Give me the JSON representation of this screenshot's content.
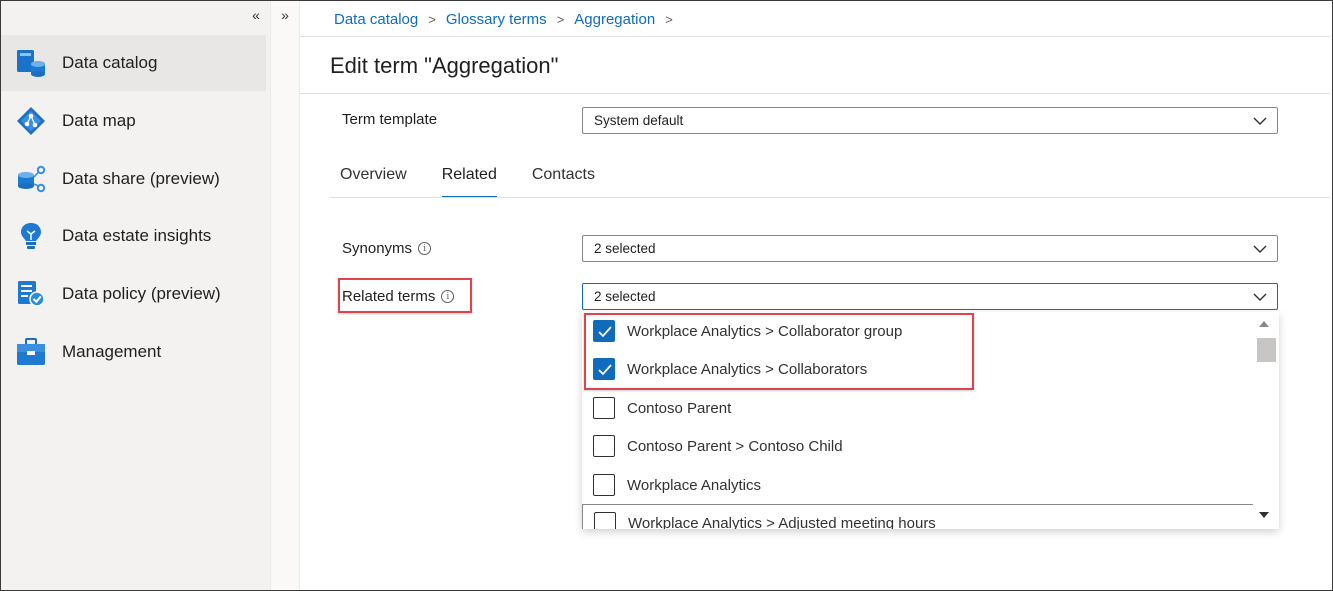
{
  "nav": {
    "collapse_label": "«",
    "expand_label": "»",
    "items": [
      {
        "label": "Data catalog",
        "icon": "data-catalog-icon",
        "active": true
      },
      {
        "label": "Data map",
        "icon": "data-map-icon"
      },
      {
        "label": "Data share (preview)",
        "icon": "data-share-icon"
      },
      {
        "label": "Data estate insights",
        "icon": "insights-lightbulb-icon"
      },
      {
        "label": "Data policy (preview)",
        "icon": "data-policy-icon"
      },
      {
        "label": "Management",
        "icon": "management-toolbox-icon"
      }
    ]
  },
  "breadcrumb": {
    "items": [
      "Data catalog",
      "Glossary terms",
      "Aggregation"
    ],
    "separator": ">"
  },
  "page": {
    "title": "Edit term \"Aggregation\""
  },
  "form": {
    "term_template": {
      "label": "Term template",
      "value": "System default"
    },
    "synonyms": {
      "label": "Synonyms",
      "value": "2 selected"
    },
    "related_terms": {
      "label": "Related terms",
      "value": "2 selected"
    },
    "info_glyph": "i"
  },
  "tabs": [
    {
      "label": "Overview"
    },
    {
      "label": "Related",
      "selected": true
    },
    {
      "label": "Contacts"
    }
  ],
  "related_options": [
    {
      "label": "Workplace Analytics > Collaborator group",
      "checked": true
    },
    {
      "label": "Workplace Analytics > Collaborators",
      "checked": true
    },
    {
      "label": "Contoso Parent",
      "checked": false
    },
    {
      "label": "Contoso Parent > Contoso Child",
      "checked": false
    },
    {
      "label": "Workplace Analytics",
      "checked": false
    },
    {
      "label": "Workplace Analytics > Adjusted meeting hours",
      "checked": false
    }
  ],
  "colors": {
    "accent": "#0f6cbd",
    "highlight": "#e0434b",
    "nav_bg": "#f3f2f1"
  }
}
